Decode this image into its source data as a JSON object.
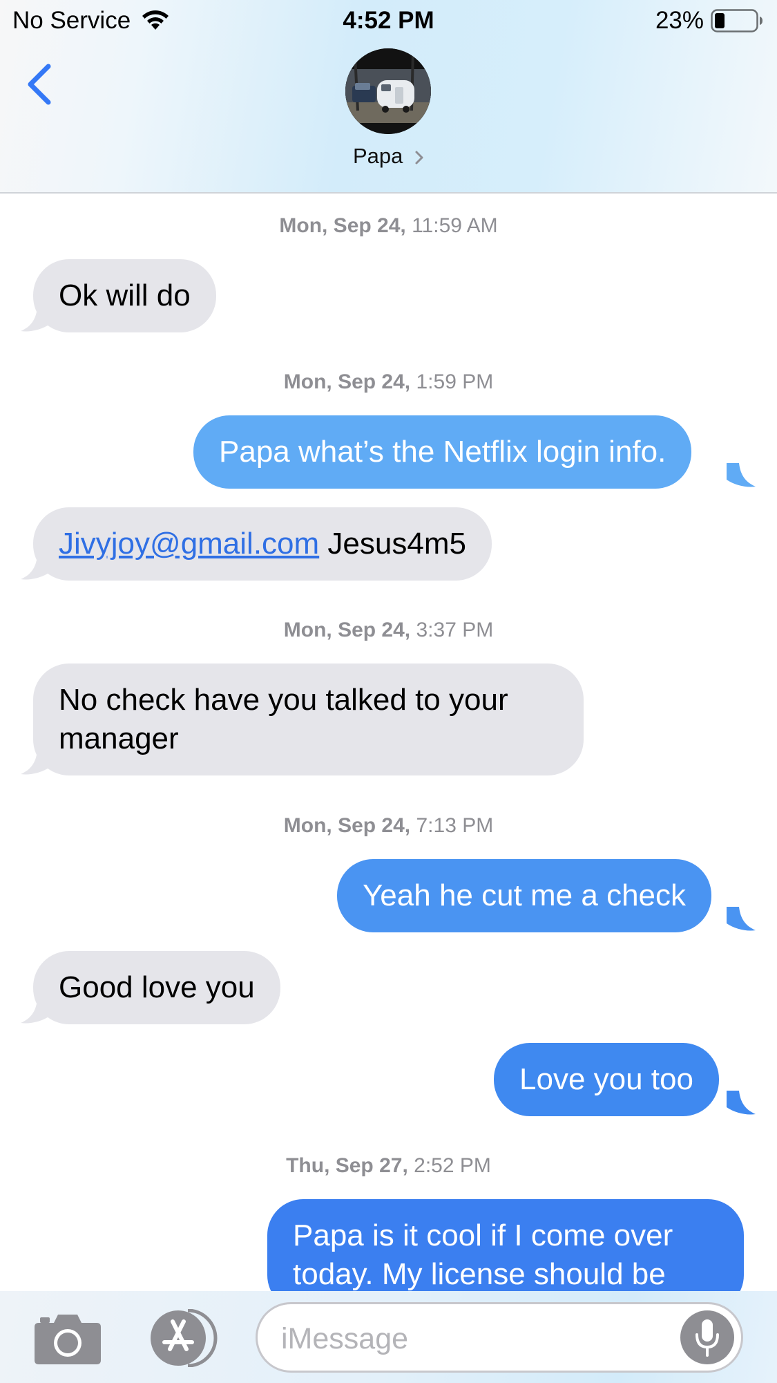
{
  "status_bar": {
    "carrier": "No Service",
    "time": "4:52 PM",
    "battery_percent": "23%",
    "battery_level": 0.23,
    "icons": [
      "wifi-icon",
      "battery-icon"
    ]
  },
  "header": {
    "back_icon": "chevron-left-icon",
    "contact_name": "Papa",
    "accent_color": "#3478f6"
  },
  "messages": [
    {
      "type": "timestamp",
      "day": "Mon, Sep 24,",
      "time": "11:59 AM"
    },
    {
      "type": "incoming",
      "text": "Ok will do"
    },
    {
      "type": "timestamp",
      "day": "Mon, Sep 24,",
      "time": "1:59 PM"
    },
    {
      "type": "outgoing",
      "text": "Papa what’s the Netflix login info.",
      "color": "#60abf5"
    },
    {
      "type": "incoming",
      "link": "Jivyjoy@gmail.com",
      "text": "Jesus4m5"
    },
    {
      "type": "timestamp",
      "day": "Mon, Sep 24,",
      "time": "3:37 PM"
    },
    {
      "type": "incoming",
      "line1": "No check have you talked to your",
      "line2": "manager"
    },
    {
      "type": "timestamp",
      "day": "Mon, Sep 24,",
      "time": "7:13 PM"
    },
    {
      "type": "outgoing",
      "text": "Yeah he cut me a check",
      "color": "#4a94f2"
    },
    {
      "type": "incoming",
      "text": "Good love you"
    },
    {
      "type": "outgoing",
      "text": "Love you too",
      "color": "#3f89f0"
    },
    {
      "type": "timestamp",
      "day": "Thu, Sep 27,",
      "time": "2:52 PM"
    },
    {
      "type": "outgoing",
      "line1": "Papa is it cool if I come over",
      "line2": "today. My license should be",
      "color": "#3b7ff0"
    }
  ],
  "composer": {
    "placeholder": "iMessage",
    "icons": [
      "camera-icon",
      "app-store-icon",
      "microphone-icon"
    ],
    "button_color": "#8e8e93"
  }
}
